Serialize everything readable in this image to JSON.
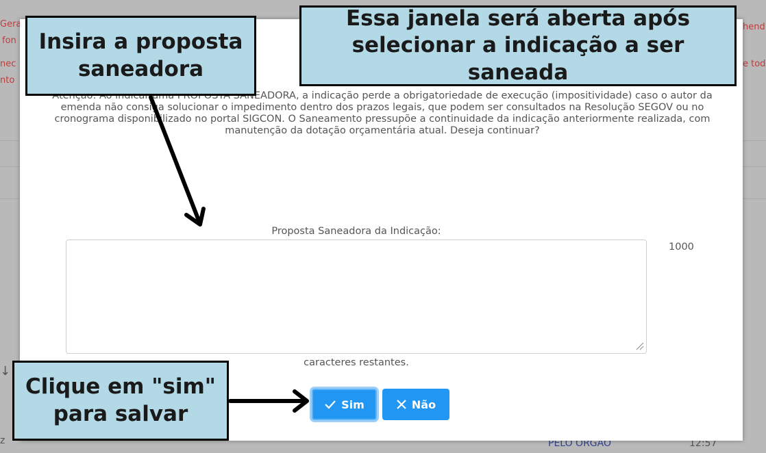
{
  "background": {
    "left_fragments": [
      "Gera",
      "fon",
      "nec",
      "nto"
    ],
    "right_fragments": [
      "hend",
      "e tod"
    ],
    "bottom_left": "z",
    "bottom_status": "PELO ÓRGÃO",
    "bottom_time": "12:57"
  },
  "dialog": {
    "warning": "Atenção: Ao indicar uma PROPOSTA SANEADORA, a indicação perde a obrigatoriedade de execução (impositividade) caso o autor da emenda não consiga solucionar o impedimento dentro dos prazos legais, que podem ser consultados na Resolução SEGOV ou no cronograma disponibilizado no portal SIGCON. O Saneamento pressupõe a continuidade da indicação anteriormente realizada, com manutenção da dotação orçamentária atual. Deseja continuar?",
    "field_label": "Proposta Saneadora da Indicação:",
    "field_value": "",
    "char_counter": "1000",
    "chars_remaining_label": "caracteres restantes.",
    "yes_label": "Sim",
    "no_label": "Não"
  },
  "annotations": {
    "insert_proposal": "Insira a proposta saneadora",
    "window_note": "Essa janela será aberta após selecionar a indicação a ser saneada",
    "click_yes": "Clique em \"sim\" para salvar"
  },
  "colors": {
    "primary_button": "#2196f3",
    "callout_bg": "#b3d8e6",
    "overlay": "#b9b9b9"
  }
}
